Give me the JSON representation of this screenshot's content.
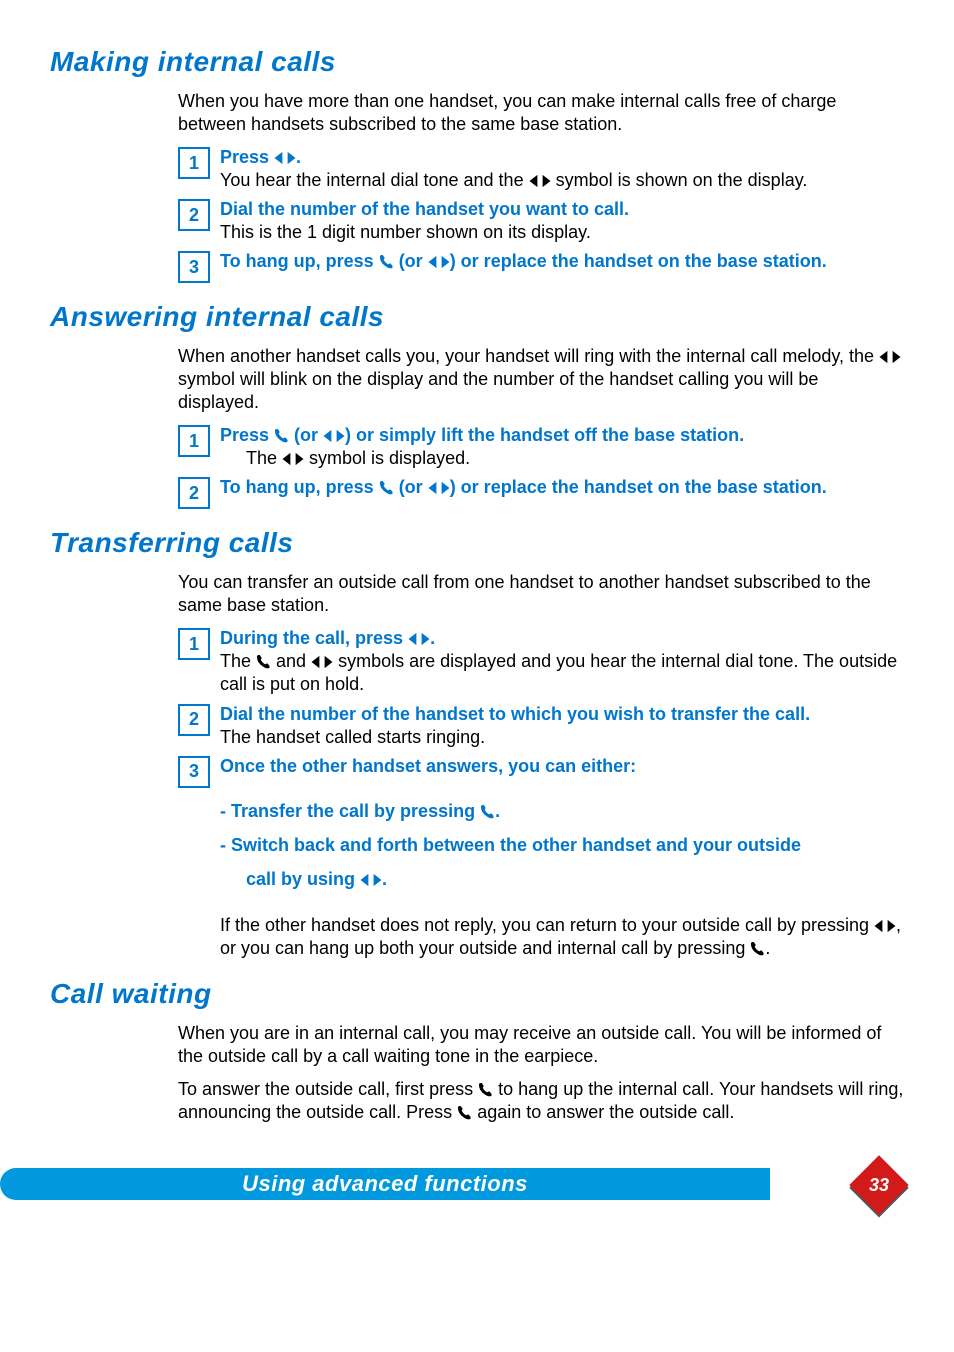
{
  "sections": {
    "making": {
      "title": "Making internal calls",
      "intro": "When you have more than one handset, you can make internal calls free of charge between handsets subscribed to the same base station.",
      "steps": [
        {
          "num": "1",
          "instr_pre": "Press ",
          "instr_post": ".",
          "body_pre": "You hear the internal dial tone and the ",
          "body_post": " symbol is shown on the display."
        },
        {
          "num": "2",
          "instr": "Dial the number of the handset you want to call.",
          "body": "This is the 1 digit number shown on its display."
        },
        {
          "num": "3",
          "instr_a": "To hang up, press ",
          "instr_b": " (or ",
          "instr_c": ") or replace the handset on the base station."
        }
      ]
    },
    "answering": {
      "title": "Answering internal calls",
      "intro_a": "When another handset calls you, your handset will ring with the internal call melody, the ",
      "intro_b": " symbol will blink on the display and the number of the handset calling you will be displayed.",
      "steps": [
        {
          "num": "1",
          "instr_a": "Press ",
          "instr_b": " (or ",
          "instr_c": ") or simply lift the handset off the base station.",
          "body_pre": "The ",
          "body_post": " symbol is displayed."
        },
        {
          "num": "2",
          "instr_a": "To hang up, press ",
          "instr_b": " (or ",
          "instr_c": ") or replace the handset on the base station."
        }
      ]
    },
    "transferring": {
      "title": "Transferring calls",
      "intro": "You can transfer an outside call from one handset to another handset subscribed to the same base station.",
      "steps": [
        {
          "num": "1",
          "instr_pre": "During the call, press ",
          "instr_post": ".",
          "body_a": "The ",
          "body_b": " and ",
          "body_c": " symbols are displayed and you hear the internal dial tone. The outside call is put on hold."
        },
        {
          "num": "2",
          "instr": "Dial the number of the handset to which you wish to transfer the call.",
          "body": "The handset called starts ringing."
        },
        {
          "num": "3",
          "instr": "Once the other handset answers, you can either:",
          "opt1_pre": "- Transfer the call by pressing ",
          "opt1_post": ".",
          "opt2": "- Switch back and forth between the other handset and your outside",
          "opt2b_pre": "call by using ",
          "opt2b_post": ".",
          "note_a": "If the other handset does not reply, you can return to your outside call by pressing ",
          "note_b": ", or you can hang up both your outside and internal call by pressing ",
          "note_c": "."
        }
      ]
    },
    "callwaiting": {
      "title": "Call waiting",
      "p1": "When you are in an internal call, you may receive an outside call.  You will be informed of the outside call by a call waiting tone in the earpiece.",
      "p2_a": "To answer the outside call, first press ",
      "p2_b": " to hang up the internal call.  Your handsets will ring, announcing the outside call.  Press ",
      "p2_c": " again to answer the outside call."
    }
  },
  "footer": {
    "label": "Using advanced functions",
    "page": "33"
  }
}
